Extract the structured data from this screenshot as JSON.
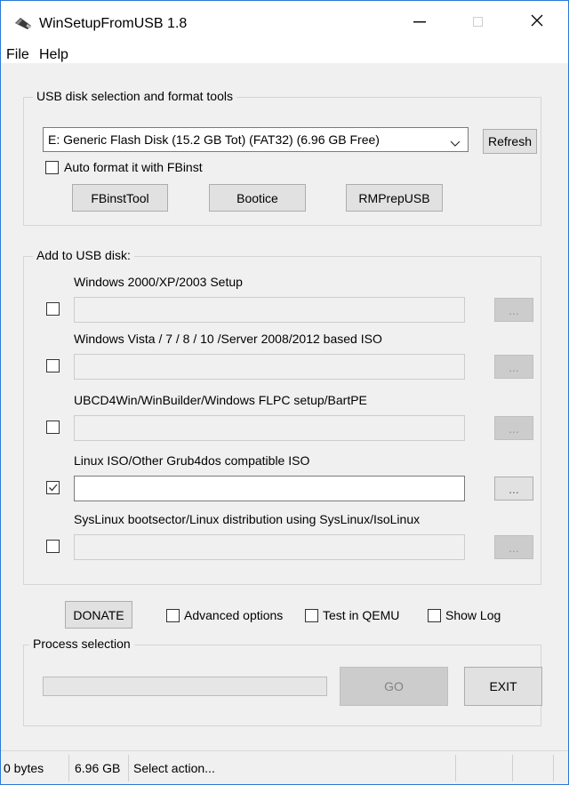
{
  "window": {
    "title": "WinSetupFromUSB 1.8",
    "icon": "usb-drive-icon",
    "minimize_glyph": "—",
    "close_glyph": "✕"
  },
  "menu": {
    "file": "File",
    "help": "Help"
  },
  "usb_group": {
    "title": "USB disk selection and format tools",
    "disk_selected": "E: Generic Flash Disk (15.2 GB Tot) (FAT32) (6.96 GB Free)",
    "refresh": "Refresh",
    "autoformat_label": "Auto format it with FBinst",
    "autoformat_checked": false,
    "fbinsttool": "FBinstTool",
    "bootice": "Bootice",
    "rmprepusb": "RMPrepUSB"
  },
  "add_group": {
    "title": "Add to USB disk:",
    "browse_label": "...",
    "items": [
      {
        "label": "Windows 2000/XP/2003 Setup",
        "checked": false,
        "value": ""
      },
      {
        "label": "Windows Vista / 7 / 8 / 10 /Server 2008/2012 based ISO",
        "checked": false,
        "value": ""
      },
      {
        "label": "UBCD4Win/WinBuilder/Windows FLPC setup/BartPE",
        "checked": false,
        "value": ""
      },
      {
        "label": "Linux ISO/Other Grub4dos compatible ISO",
        "checked": true,
        "value": ""
      },
      {
        "label": "SysLinux bootsector/Linux distribution using SysLinux/IsoLinux",
        "checked": false,
        "value": ""
      }
    ]
  },
  "options": {
    "donate": "DONATE",
    "advanced": "Advanced options",
    "advanced_checked": false,
    "qemu": "Test in QEMU",
    "qemu_checked": false,
    "showlog": "Show Log",
    "showlog_checked": false
  },
  "process": {
    "title": "Process selection",
    "progress": 0,
    "go": "GO",
    "exit": "EXIT"
  },
  "status": {
    "bytes": "0 bytes",
    "free": "6.96 GB",
    "message": "Select action..."
  },
  "colors": {
    "accent_border": "#2b79d6",
    "face": "#f0f0f0",
    "progress_fill": "#06b025"
  }
}
